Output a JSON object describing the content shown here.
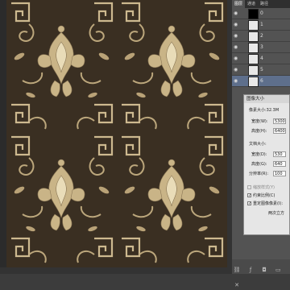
{
  "colors": {
    "canvas_bg": "#2b2b2b",
    "pattern_bg": "#3a2f22",
    "ornament": "#d8c59c",
    "panel": "#535353",
    "selected_layer": "#5e6f8c"
  },
  "panel": {
    "tabs": [
      "图层",
      "通道",
      "路径"
    ],
    "layers": [
      {
        "name": "0",
        "thumb": "black"
      },
      {
        "name": "1",
        "thumb": "white"
      },
      {
        "name": "2",
        "thumb": "white"
      },
      {
        "name": "3",
        "thumb": "white"
      },
      {
        "name": "4",
        "thumb": "white"
      },
      {
        "name": "5",
        "thumb": "white"
      },
      {
        "name": "6",
        "thumb": "white"
      }
    ],
    "selected_index": 6
  },
  "dialog": {
    "title": "图像大小",
    "size_label": "像素大小:32.3M",
    "width_label": "宽度(W):",
    "width_value": "5300",
    "height_label": "高度(H):",
    "height_value": "6400",
    "doc_size_label": "文档大小:",
    "doc_width_label": "宽度(D):",
    "doc_width_value": "530",
    "doc_height_label": "高度(G):",
    "doc_height_value": "640",
    "resolution_label": "分辨率(R):",
    "resolution_value": "100",
    "scale_styles": "缩放样式(Y)",
    "constrain": "约束比例(C)",
    "resample": "重定图像像素(I):",
    "method": "两次立方"
  }
}
